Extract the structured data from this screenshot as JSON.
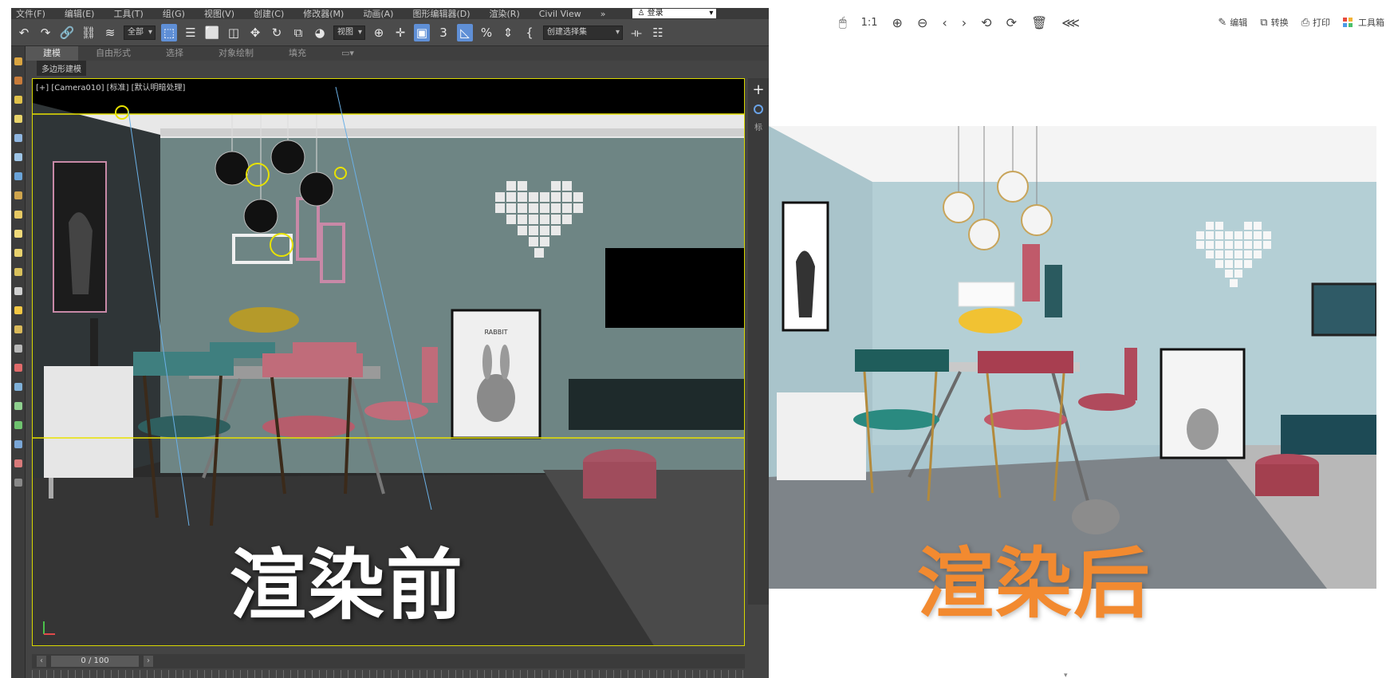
{
  "max_window": {
    "menu": [
      "文件(F)",
      "编辑(E)",
      "工具(T)",
      "组(G)",
      "视图(V)",
      "创建(C)",
      "修改器(M)",
      "动画(A)",
      "图形编辑器(D)",
      "渲染(R)",
      "Civil View",
      "»"
    ],
    "login_label": "登录",
    "toolbar": {
      "selection_filter": "全部",
      "coordinate_system": "视图",
      "named_selection_set": "创建选择集"
    },
    "ribbon_tabs": [
      "建模",
      "自由形式",
      "选择",
      "对象绘制",
      "填充"
    ],
    "ribbon_subpanel": "多边形建模",
    "viewport_label": "[+] [Camera010] [标准] [默认明暗处理]",
    "time_slider": "0 / 100"
  },
  "captions": {
    "before": "渲染前",
    "after": "渲染后"
  },
  "viewer": {
    "toolbar_icons": [
      "mouse-icon",
      "actual-size-icon",
      "zoom-in-icon",
      "zoom-out-icon",
      "previous-icon",
      "next-icon",
      "rotate-left-icon",
      "rotate-right-icon",
      "delete-icon",
      "share-icon"
    ],
    "actual_size_label": "1:1",
    "actions": {
      "edit": "编辑",
      "convert": "转换",
      "print": "打印",
      "tools": "工具箱"
    }
  },
  "scene_text": {
    "poster_brand": "RABBIT"
  },
  "colors": {
    "caption_after": "#f28a30",
    "viewport_frame": "#d8d800",
    "active_tool": "#5f8fd6"
  }
}
